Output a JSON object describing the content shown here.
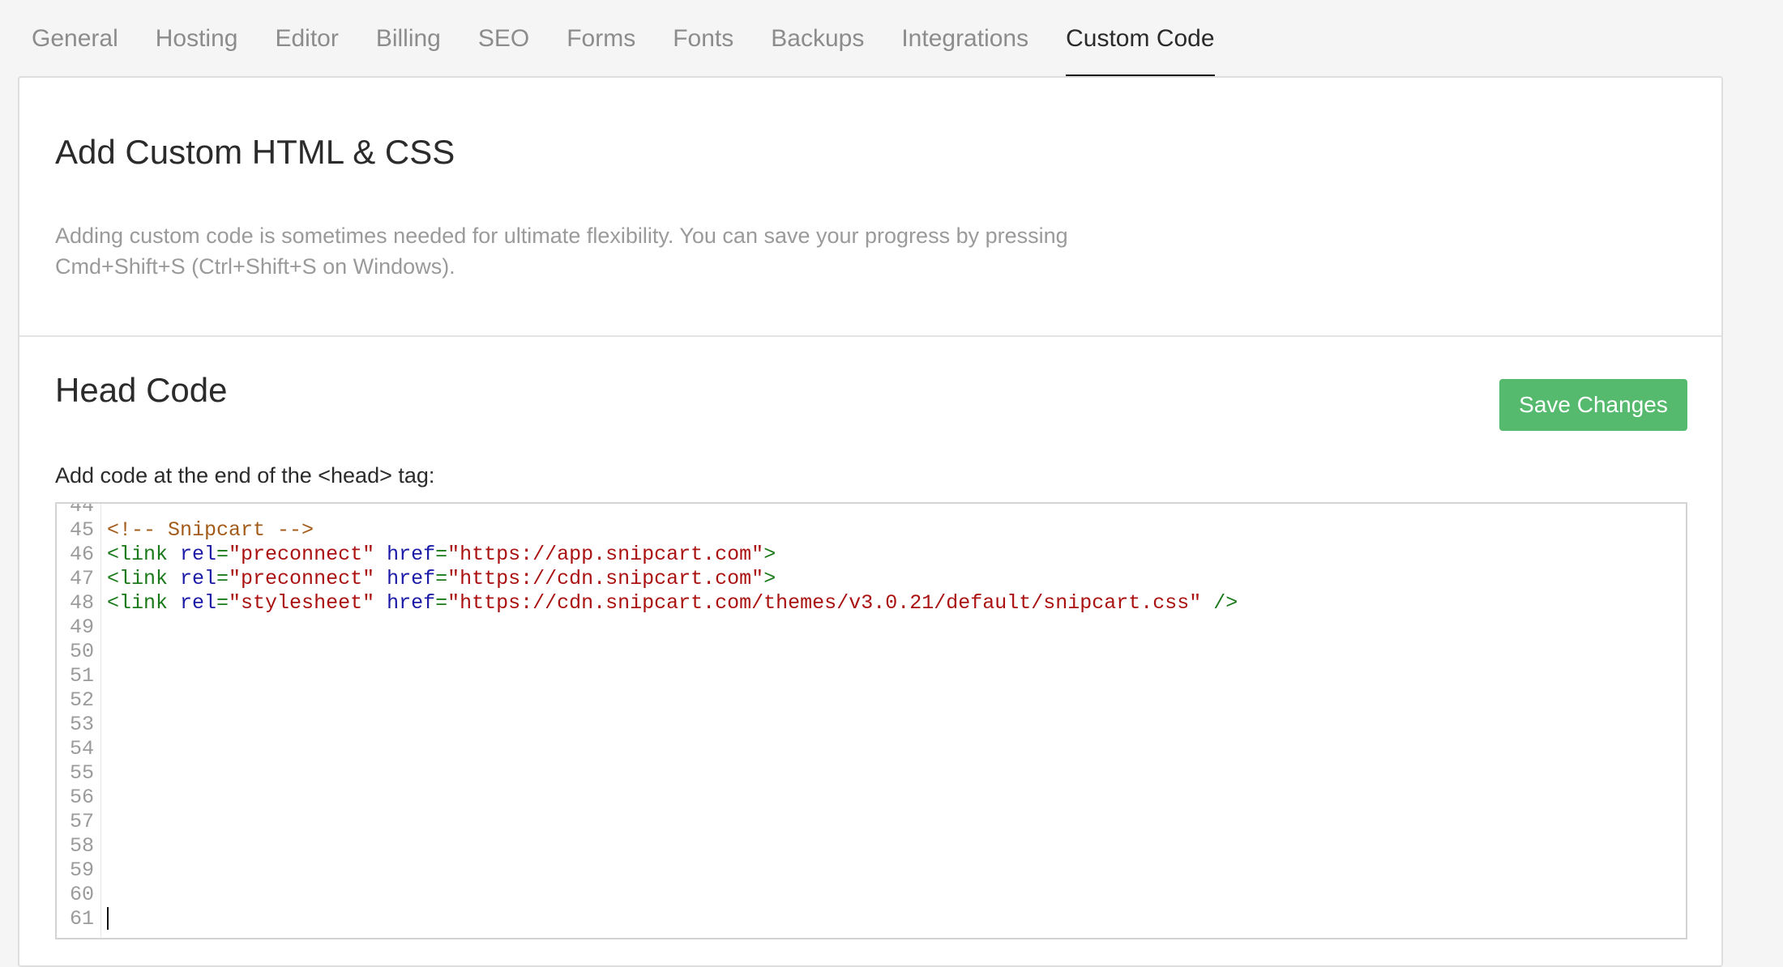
{
  "tabs": [
    {
      "label": "General",
      "active": false
    },
    {
      "label": "Hosting",
      "active": false
    },
    {
      "label": "Editor",
      "active": false
    },
    {
      "label": "Billing",
      "active": false
    },
    {
      "label": "SEO",
      "active": false
    },
    {
      "label": "Forms",
      "active": false
    },
    {
      "label": "Fonts",
      "active": false
    },
    {
      "label": "Backups",
      "active": false
    },
    {
      "label": "Integrations",
      "active": false
    },
    {
      "label": "Custom Code",
      "active": true
    }
  ],
  "intro": {
    "title": "Add Custom HTML & CSS",
    "description": "Adding custom code is sometimes needed for ultimate flexibility. You can save your progress by pressing Cmd+Shift+S (Ctrl+Shift+S on Windows)."
  },
  "head_code": {
    "title": "Head Code",
    "save_label": "Save Changes",
    "field_label": "Add code at the end of the <head> tag:",
    "editor": {
      "lines": [
        {
          "n": "44",
          "code": ""
        },
        {
          "n": "45",
          "code": "<!-- Snipcart -->"
        },
        {
          "n": "46",
          "code": "<link rel=\"preconnect\" href=\"https://app.snipcart.com\">"
        },
        {
          "n": "47",
          "code": "<link rel=\"preconnect\" href=\"https://cdn.snipcart.com\">"
        },
        {
          "n": "48",
          "code": "<link rel=\"stylesheet\" href=\"https://cdn.snipcart.com/themes/v3.0.21/default/snipcart.css\" />"
        },
        {
          "n": "49",
          "code": ""
        },
        {
          "n": "50",
          "code": ""
        },
        {
          "n": "51",
          "code": ""
        },
        {
          "n": "52",
          "code": ""
        },
        {
          "n": "53",
          "code": ""
        },
        {
          "n": "54",
          "code": ""
        },
        {
          "n": "55",
          "code": ""
        },
        {
          "n": "56",
          "code": ""
        },
        {
          "n": "57",
          "code": ""
        },
        {
          "n": "58",
          "code": ""
        },
        {
          "n": "59",
          "code": ""
        },
        {
          "n": "60",
          "code": ""
        },
        {
          "n": "61",
          "code": ""
        }
      ],
      "cursor_line": "61"
    }
  },
  "colors": {
    "accent_green": "#55b96e",
    "active_tab_underline": "#111111",
    "muted_text": "#9a9a9a"
  }
}
